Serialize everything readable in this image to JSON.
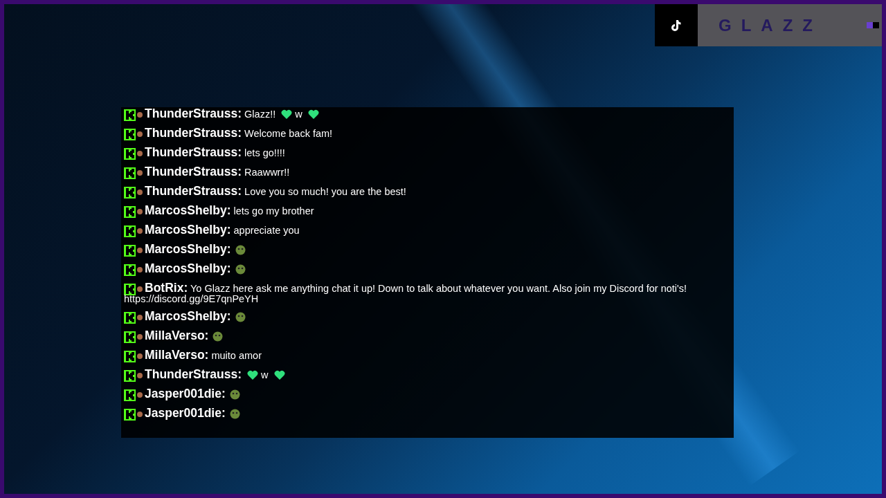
{
  "brand": {
    "name": "GLAZZ"
  },
  "chat": [
    {
      "user": "ThunderStrauss:",
      "parts": [
        {
          "kind": "text",
          "text": "Glazz!!"
        },
        {
          "kind": "heart"
        },
        {
          "kind": "text",
          "text": "w"
        },
        {
          "kind": "heart"
        }
      ]
    },
    {
      "user": "ThunderStrauss:",
      "parts": [
        {
          "kind": "text",
          "text": "Welcome back fam!"
        }
      ]
    },
    {
      "user": "ThunderStrauss:",
      "parts": [
        {
          "kind": "text",
          "text": "lets go!!!!"
        }
      ]
    },
    {
      "user": "ThunderStrauss:",
      "parts": [
        {
          "kind": "text",
          "text": "Raawwrr!!"
        }
      ]
    },
    {
      "user": "ThunderStrauss:",
      "parts": [
        {
          "kind": "text",
          "text": "Love you so much! you are the best!"
        }
      ]
    },
    {
      "user": "MarcosShelby:",
      "parts": [
        {
          "kind": "text",
          "text": "lets go my brother"
        }
      ]
    },
    {
      "user": "MarcosShelby:",
      "parts": [
        {
          "kind": "text",
          "text": "appreciate you"
        }
      ]
    },
    {
      "user": "MarcosShelby:",
      "parts": [
        {
          "kind": "emote"
        }
      ]
    },
    {
      "user": "MarcosShelby:",
      "parts": [
        {
          "kind": "emote"
        }
      ]
    },
    {
      "user": "BotRix:",
      "parts": [
        {
          "kind": "text",
          "text": "Yo Glazz here ask me anything chat it up! Down to talk about whatever you want. Also join my Discord for noti's!"
        },
        {
          "kind": "newline-text",
          "text": "https://discord.gg/9E7qnPeYH"
        }
      ]
    },
    {
      "user": "MarcosShelby:",
      "parts": [
        {
          "kind": "emote"
        }
      ]
    },
    {
      "user": "MillaVerso:",
      "parts": [
        {
          "kind": "emote"
        }
      ]
    },
    {
      "user": "MillaVerso:",
      "parts": [
        {
          "kind": "text",
          "text": "muito amor"
        }
      ]
    },
    {
      "user": "ThunderStrauss:",
      "parts": [
        {
          "kind": "heart"
        },
        {
          "kind": "text",
          "text": "w"
        },
        {
          "kind": "heart"
        }
      ]
    },
    {
      "user": "Jasper001die:",
      "parts": [
        {
          "kind": "emote"
        }
      ]
    },
    {
      "user": "Jasper001die:",
      "parts": [
        {
          "kind": "emote"
        }
      ]
    }
  ]
}
